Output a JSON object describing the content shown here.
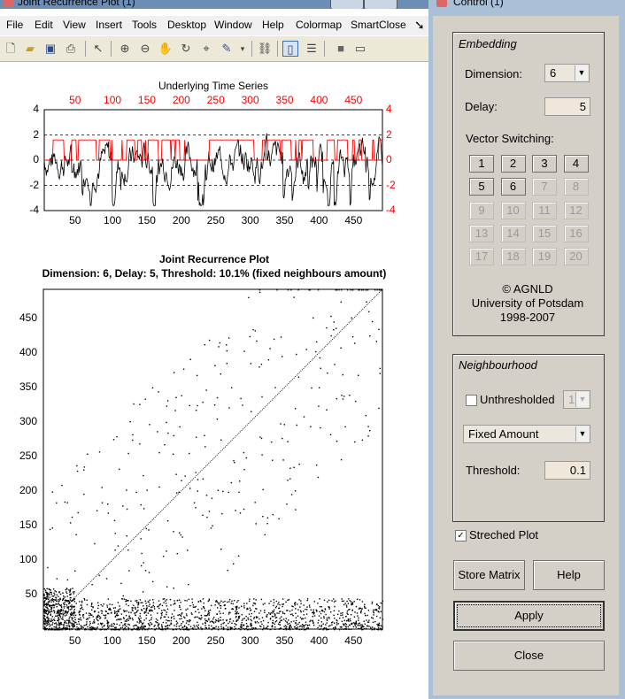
{
  "figure_window": {
    "title": "Joint Recurrence Plot (1)",
    "menu": [
      "File",
      "Edit",
      "View",
      "Insert",
      "Tools",
      "Desktop",
      "Window",
      "Help",
      "Colormap",
      "SmartClose"
    ],
    "toolbar_icons": [
      "new-file-icon",
      "open-folder-icon",
      "save-icon",
      "print-icon",
      "arrow-select-icon",
      "zoom-in-icon",
      "zoom-out-icon",
      "pan-hand-icon",
      "rotate-3d-icon",
      "data-cursor-icon",
      "brush-icon",
      "dropdown-icon",
      "link-plot-icon",
      "colorbar-icon",
      "legend-icon",
      "hide-plot-tools-icon",
      "show-plot-tools-icon"
    ]
  },
  "timeseries_plot": {
    "title": "Underlying Time Series",
    "x_ticks": [
      "50",
      "100",
      "150",
      "200",
      "250",
      "300",
      "350",
      "400",
      "450"
    ],
    "y_ticks_left": [
      "4",
      "2",
      "0",
      "-2",
      "-4"
    ],
    "y_ticks_right": [
      "4",
      "2",
      "0",
      "-2",
      "-4"
    ],
    "top_ticks": [
      "50",
      "100",
      "150",
      "200",
      "250",
      "300",
      "350",
      "400",
      "450"
    ],
    "colors": {
      "series1": "#000000",
      "series2": "#ff0000"
    }
  },
  "recurrence_plot": {
    "title": "Joint Recurrence Plot",
    "subtitle": "Dimension: 6,  Delay: 5,  Threshold: 10.1% (fixed neighbours amount)",
    "x_ticks": [
      "50",
      "100",
      "150",
      "200",
      "250",
      "300",
      "350",
      "400",
      "450"
    ],
    "y_ticks": [
      "450",
      "400",
      "350",
      "300",
      "250",
      "200",
      "150",
      "100",
      "50"
    ]
  },
  "control_window": {
    "title": "Control (1)",
    "embedding": {
      "title": "Embedding",
      "dimension_label": "Dimension:",
      "dimension_value": "6",
      "delay_label": "Delay:",
      "delay_value": "5",
      "vector_switching_label": "Vector Switching:",
      "vector_buttons": [
        "1",
        "2",
        "3",
        "4",
        "5",
        "6",
        "7",
        "8",
        "9",
        "10",
        "11",
        "12",
        "13",
        "14",
        "15",
        "16",
        "17",
        "18",
        "19",
        "20"
      ],
      "enabled_count": 6,
      "copyright": "© AGNLD",
      "university": "University of Potsdam",
      "years": "1998-2007"
    },
    "neighbourhood": {
      "title": "Neighbourhood",
      "unthresholded_label": "Unthresholded",
      "unthresholded_checked": false,
      "unthresholded_value": "1",
      "method": "Fixed Amount",
      "threshold_label": "Threshold:",
      "threshold_value": "0.1"
    },
    "streched_plot_label": "Streched Plot",
    "streched_plot_checked": true,
    "buttons": {
      "store_matrix": "Store Matrix",
      "help": "Help",
      "apply": "Apply",
      "close": "Close"
    }
  }
}
